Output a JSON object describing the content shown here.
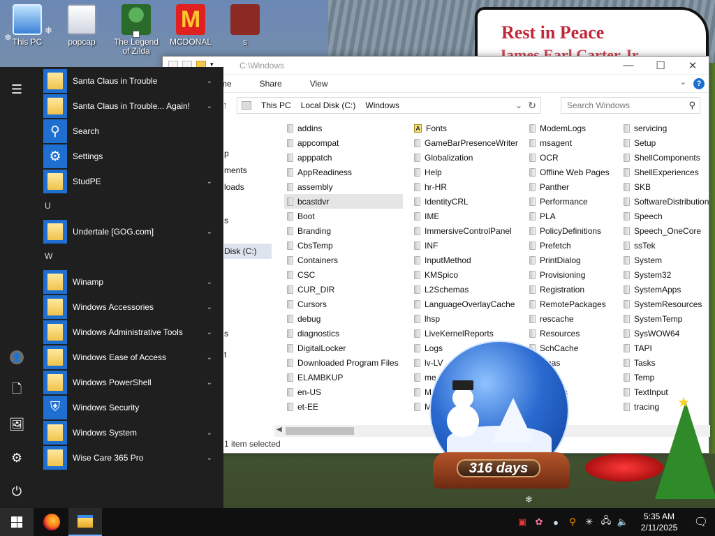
{
  "desktop": {
    "icons": [
      {
        "label": "This PC"
      },
      {
        "label": "popcap"
      },
      {
        "label": "The Legend of Zilda"
      },
      {
        "label": "MCDONAL",
        "mark": "M"
      },
      {
        "label": "s"
      }
    ],
    "sign": {
      "title": "Rest in Peace",
      "subtitle": "James Earl Carter Jr."
    },
    "countdown": "316 days"
  },
  "explorer": {
    "title": "C:\\Windows",
    "window_buttons": {
      "minimize": "—",
      "maximize": "☐",
      "close": "✕"
    },
    "ribbon_tabs": [
      "me",
      "Share",
      "View"
    ],
    "help": "?",
    "breadcrumb": [
      "This PC",
      "Local Disk (C:)",
      "Windows"
    ],
    "search_placeholder": "Search Windows",
    "nav_items": [
      "p",
      "ments",
      "loads",
      "s",
      "Disk (C:)",
      "s",
      "t"
    ],
    "columns": [
      [
        "addins",
        "appcompat",
        "apppatch",
        "AppReadiness",
        "assembly",
        "bcastdvr",
        "Boot",
        "Branding",
        "CbsTemp",
        "Containers",
        "CSC",
        "CUR_DIR",
        "Cursors",
        "debug",
        "diagnostics",
        "DigitalLocker",
        "Downloaded Program Files",
        "ELAMBKUP",
        "en-US",
        "et-EE"
      ],
      [
        "Fonts",
        "GameBarPresenceWriter",
        "Globalization",
        "Help",
        "hr-HR",
        "IdentityCRL",
        "IME",
        "ImmersiveControlPanel",
        "INF",
        "InputMethod",
        "KMSpico",
        "L2Schemas",
        "LanguageOverlayCache",
        "lhsp",
        "LiveKernelReports",
        "Logs",
        "lv-LV",
        "me",
        "M",
        "M"
      ],
      [
        "ModemLogs",
        "msagent",
        "OCR",
        "Offline Web Pages",
        "Panther",
        "Performance",
        "PLA",
        "PolicyDefinitions",
        "Prefetch",
        "PrintDialog",
        "Provisioning",
        "Registration",
        "RemotePackages",
        "rescache",
        "Resources",
        "SchCache",
        "emas",
        "ity",
        "Profiles",
        "tate"
      ],
      [
        "servicing",
        "Setup",
        "ShellComponents",
        "ShellExperiences",
        "SKB",
        "SoftwareDistribution",
        "Speech",
        "Speech_OneCore",
        "ssTek",
        "System",
        "System32",
        "SystemApps",
        "SystemResources",
        "SystemTemp",
        "SysWOW64",
        "TAPI",
        "Tasks",
        "Temp",
        "TextInput",
        "tracing"
      ]
    ],
    "selected": "bcastdvr",
    "status": "1 item selected"
  },
  "start_menu": {
    "groups": [
      {
        "type": "app",
        "label": "Santa Claus in Trouble",
        "tile": "folder",
        "expand": true
      },
      {
        "type": "app",
        "label": "Santa Claus in Trouble... Again!",
        "tile": "folder",
        "expand": true
      },
      {
        "type": "app",
        "label": "Search",
        "tile": "search",
        "expand": false
      },
      {
        "type": "app",
        "label": "Settings",
        "tile": "gear",
        "expand": false
      },
      {
        "type": "app",
        "label": "StudPE",
        "tile": "folder",
        "expand": true
      },
      {
        "type": "letter",
        "label": "U"
      },
      {
        "type": "app",
        "label": "Undertale [GOG.com]",
        "tile": "folder",
        "expand": true
      },
      {
        "type": "letter",
        "label": "W"
      },
      {
        "type": "app",
        "label": "Winamp",
        "tile": "folder",
        "expand": true
      },
      {
        "type": "app",
        "label": "Windows Accessories",
        "tile": "folder",
        "expand": true
      },
      {
        "type": "app",
        "label": "Windows Administrative Tools",
        "tile": "folder",
        "expand": true
      },
      {
        "type": "app",
        "label": "Windows Ease of Access",
        "tile": "folder",
        "expand": true
      },
      {
        "type": "app",
        "label": "Windows PowerShell",
        "tile": "folder",
        "expand": true
      },
      {
        "type": "app",
        "label": "Windows Security",
        "tile": "shield",
        "expand": false
      },
      {
        "type": "app",
        "label": "Windows System",
        "tile": "folder",
        "expand": true
      },
      {
        "type": "app",
        "label": "Wise Care 365 Pro",
        "tile": "folder",
        "expand": true
      }
    ],
    "rail": [
      "hamburger-icon",
      "user-icon",
      "documents-icon",
      "pictures-icon",
      "settings-icon",
      "power-icon"
    ]
  },
  "taskbar": {
    "apps": [
      "firefox-icon",
      "file-explorer-icon"
    ],
    "time": "5:35 AM",
    "date": "2/11/2025",
    "tray_icons": [
      "security-icon",
      "colorful-app-icon",
      "drop-icon",
      "search-orange-icon",
      "brightness-icon",
      "network-icon",
      "volume-icon"
    ]
  },
  "colors": {
    "start_bg": "#1f1f1f",
    "tile_blue": "#1f6fd1",
    "accent": "#0078d7",
    "rip_red": "#c2273a"
  }
}
